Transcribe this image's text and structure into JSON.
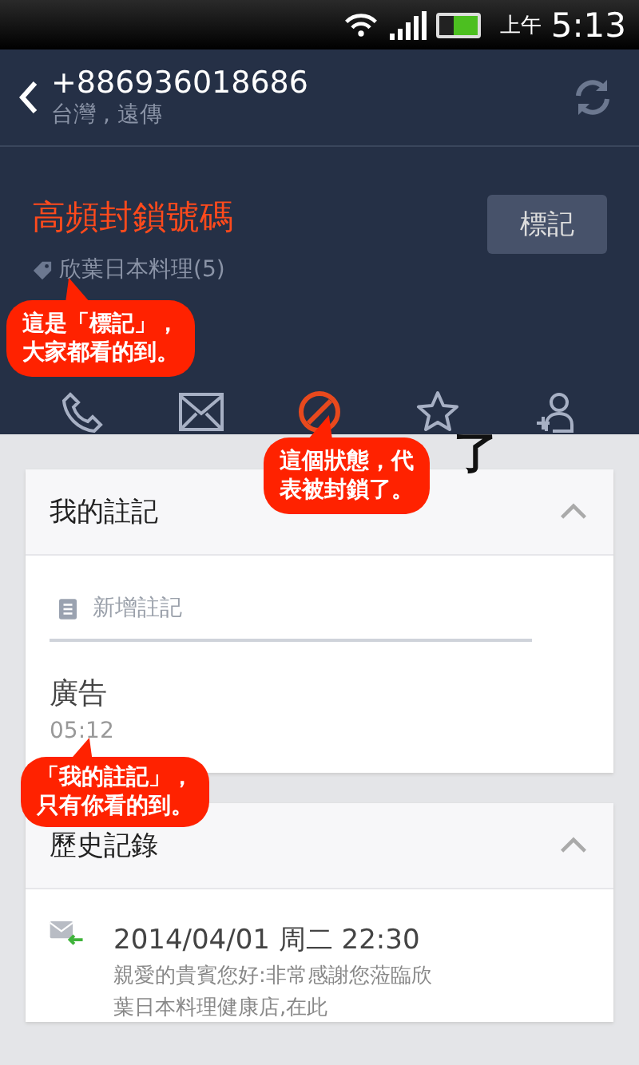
{
  "status_bar": {
    "am_pm": "上午",
    "time": "5:13"
  },
  "contact": {
    "number": "+886936018686",
    "carrier": "台灣 , 遠傳"
  },
  "block_info": {
    "title": "高頻封鎖號碼",
    "tag": "欣葉日本料理(5)",
    "mark_button": "標記"
  },
  "actions": [
    {
      "kind": "call",
      "selected": false
    },
    {
      "kind": "sms",
      "selected": false
    },
    {
      "kind": "block",
      "selected": true
    },
    {
      "kind": "favorite",
      "selected": false
    },
    {
      "kind": "add_contact",
      "selected": false
    }
  ],
  "partial_caption": "了",
  "my_notes": {
    "title": "我的註記",
    "expanded": true,
    "placeholder": "新增註記",
    "entries": [
      {
        "text": "廣告",
        "time": "05:12"
      }
    ]
  },
  "history": {
    "title": "歷史記錄",
    "expanded": true,
    "items": [
      {
        "datetime": "2014/04/01 周二 22:30",
        "lines": [
          "親愛的貴賓您好:非常感謝您蒞臨欣",
          "葉日本料理健康店,在此"
        ]
      }
    ]
  },
  "callouts": [
    {
      "lines": [
        "這是「標記」，",
        "大家都看的到。"
      ]
    },
    {
      "lines": [
        "這個狀態，代",
        "表被封鎖了。"
      ]
    },
    {
      "lines": [
        "「我的註記」，",
        "只有你看的到。"
      ]
    }
  ]
}
